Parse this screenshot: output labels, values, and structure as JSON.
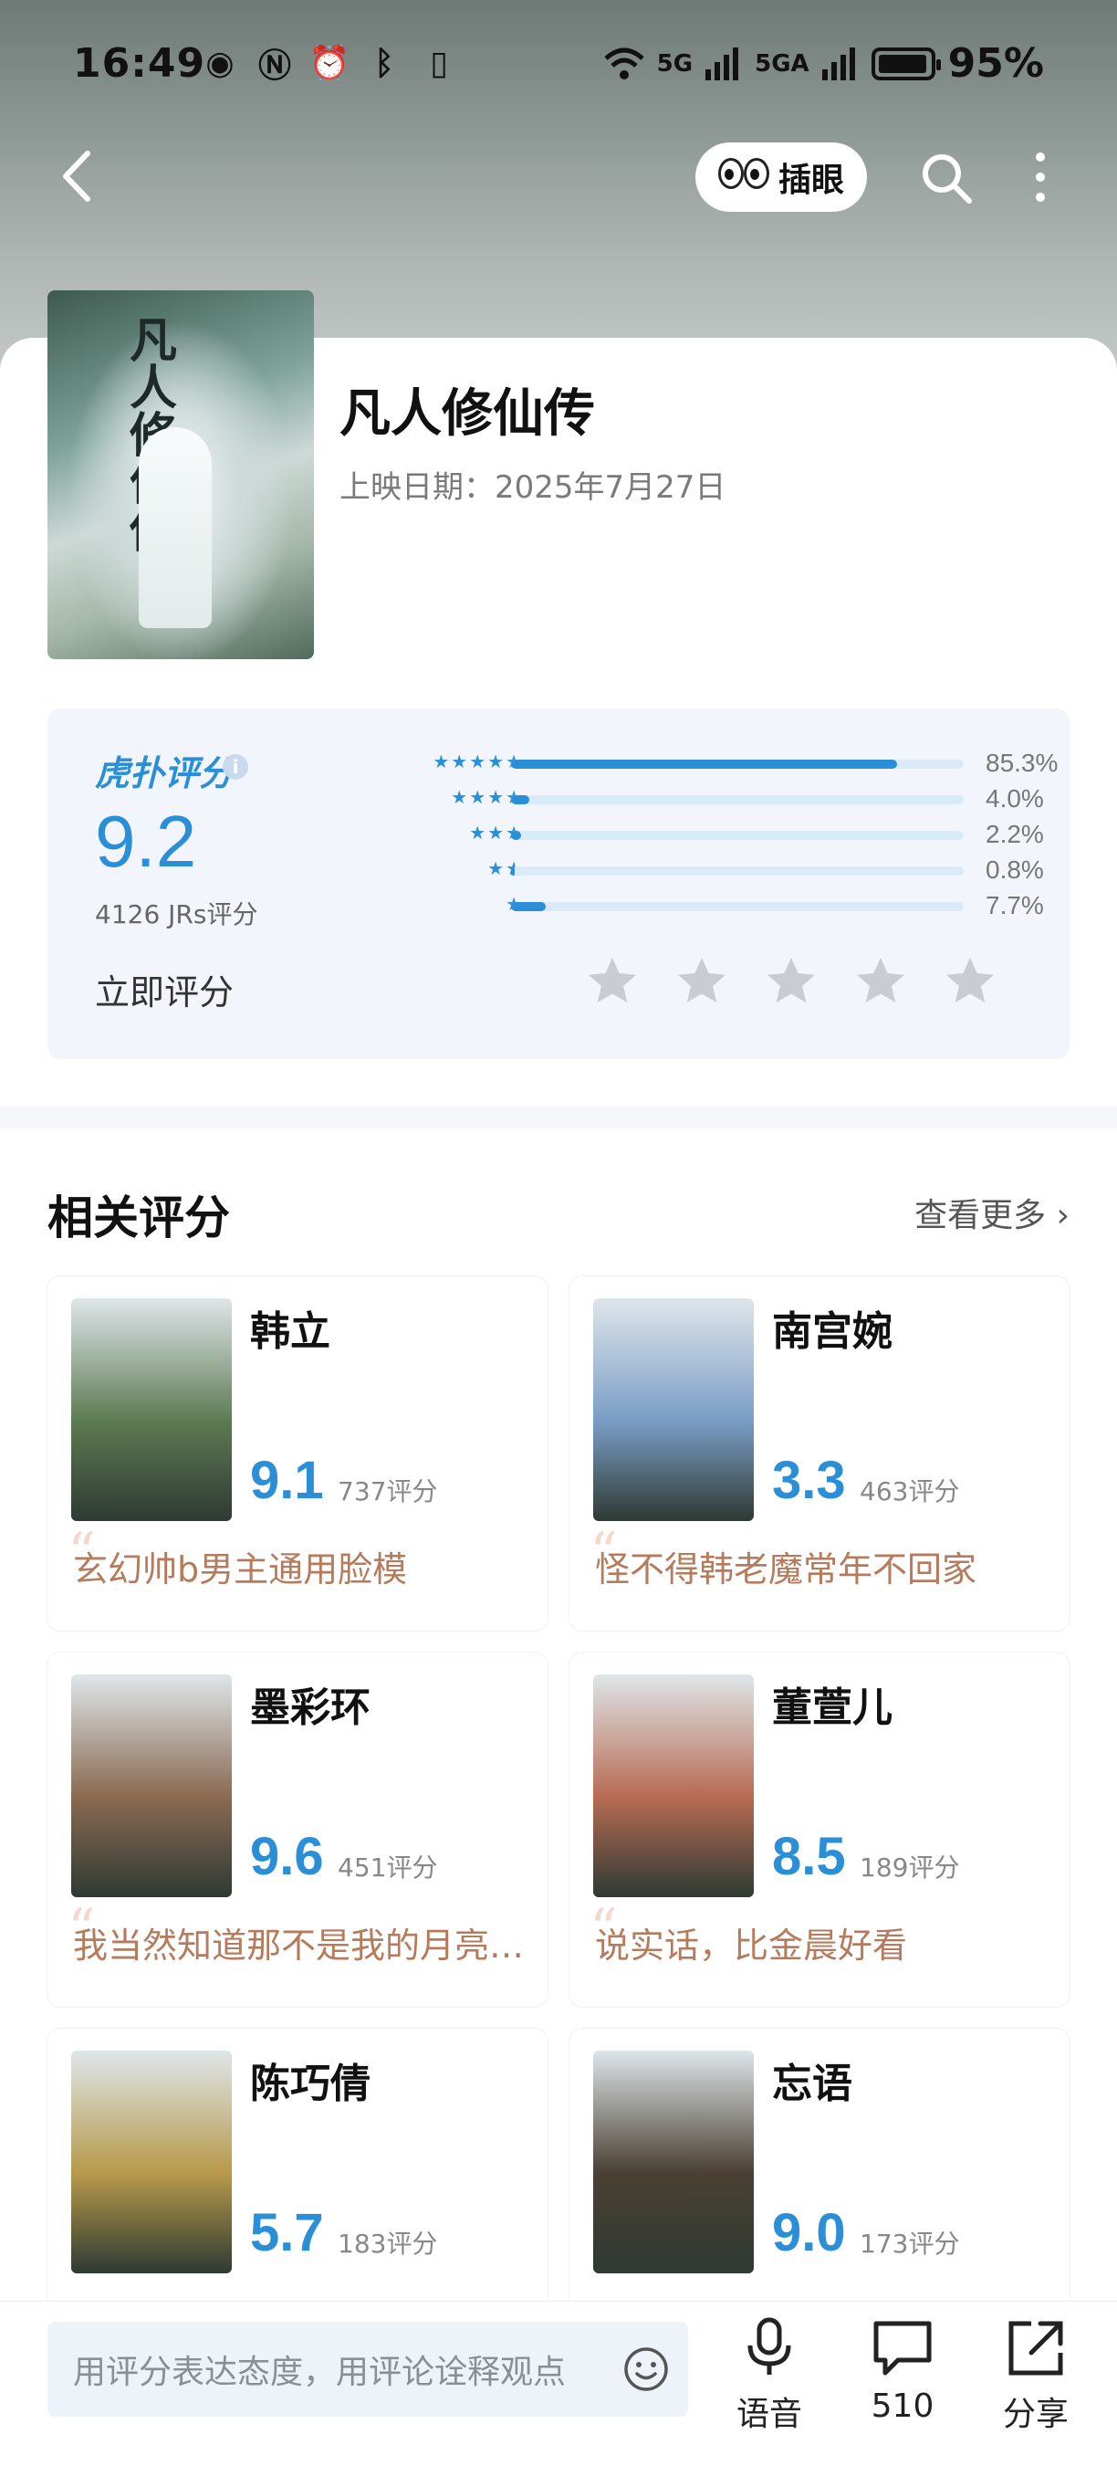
{
  "status_bar": {
    "time": "16:49",
    "battery": "95%",
    "net1": "5G",
    "net2": "5GA"
  },
  "topnav": {
    "peek_label": "插眼"
  },
  "show": {
    "title": "凡人修仙传",
    "release_date": "上映日期：2025年7月27日",
    "poster_title": "凡人修仙传"
  },
  "rating": {
    "brand": "虎扑评分",
    "score": "9.2",
    "count": "4126 JRs评分",
    "rate_now": "立即评分",
    "distribution": [
      {
        "stars": 5,
        "percent": 85.3,
        "label": "85.3%"
      },
      {
        "stars": 4,
        "percent": 4.0,
        "label": "4.0%"
      },
      {
        "stars": 3,
        "percent": 2.2,
        "label": "2.2%"
      },
      {
        "stars": 2,
        "percent": 0.8,
        "label": "0.8%"
      },
      {
        "stars": 1,
        "percent": 7.7,
        "label": "7.7%"
      }
    ]
  },
  "related": {
    "title": "相关评分",
    "see_more": "查看更多 ›",
    "items": [
      {
        "name": "韩立",
        "score": "9.1",
        "count": "737评分",
        "quote": "玄幻帅b男主通用脸模",
        "color": "#5d7b52"
      },
      {
        "name": "南宫婉",
        "score": "3.3",
        "count": "463评分",
        "quote": "怪不得韩老魔常年不回家",
        "color": "#7a9dc6"
      },
      {
        "name": "墨彩环",
        "score": "9.6",
        "count": "451评分",
        "quote": "我当然知道那不是我的月亮…",
        "color": "#8a6a52"
      },
      {
        "name": "董萱儿",
        "score": "8.5",
        "count": "189评分",
        "quote": "说实话，比金晨好看",
        "color": "#b86b52"
      },
      {
        "name": "陈巧倩",
        "score": "5.7",
        "count": "183评分",
        "quote": "",
        "color": "#b7994a"
      },
      {
        "name": "忘语",
        "score": "9.0",
        "count": "173评分",
        "quote": "",
        "color": "#4a4033"
      }
    ]
  },
  "bottom": {
    "placeholder": "用评分表达态度，用评论诠释观点",
    "voice_label": "语音",
    "comment_count": "510",
    "share_label": "分享"
  }
}
